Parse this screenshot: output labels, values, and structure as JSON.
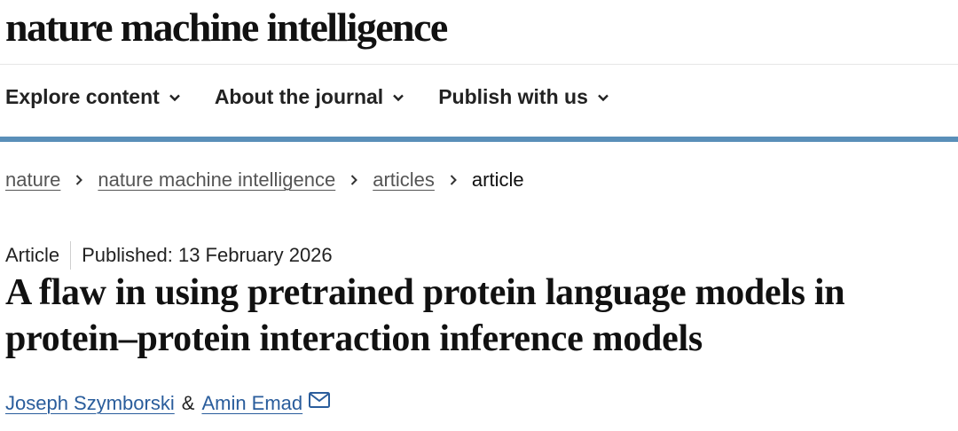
{
  "site": {
    "masthead": "nature machine intelligence"
  },
  "nav": {
    "items": [
      {
        "label": "Explore content",
        "icon": "chevron-down-icon"
      },
      {
        "label": "About the journal",
        "icon": "chevron-down-icon"
      },
      {
        "label": "Publish with us",
        "icon": "chevron-down-icon"
      }
    ]
  },
  "breadcrumb": {
    "items": [
      "nature",
      "nature machine intelligence",
      "articles"
    ],
    "current": "article"
  },
  "article": {
    "type": "Article",
    "published": "Published: 13 February 2026",
    "title": "A flaw in using pretrained protein language models in protein–protein interaction inference models",
    "authors": [
      "Joseph Szymborski",
      "Amin Emad"
    ],
    "separator": "&",
    "contact_icon": "mail-icon"
  },
  "colors": {
    "accent_bar": "#5a8fb9",
    "author_link": "#2a5d9c"
  }
}
